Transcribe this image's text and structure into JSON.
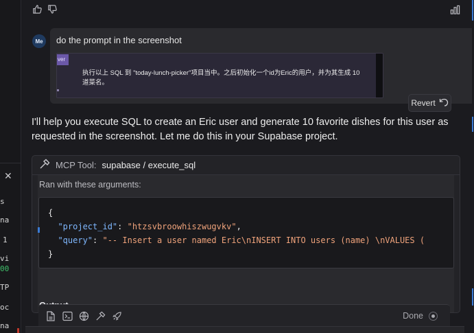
{
  "left_pane": {
    "close_glyph": "✕",
    "fragments": [
      "s",
      "na",
      "1",
      "vi",
      "00",
      "TP",
      "oc",
      "na"
    ]
  },
  "feedback": {
    "thumbs_up": "thumbs-up-icon",
    "thumbs_down": "thumbs-down-icon",
    "stats": "bar-chart-icon"
  },
  "user_message": {
    "avatar": "Me",
    "text": "do the prompt in the screenshot",
    "screenshot_tag": "ver",
    "screenshot_text": "执行以上 SQL 到 \"today-lunch-picker\"项目当中。之后初始化一个id为Eric的用户，并为其生成 10 道菜名。",
    "revert_label": "Revert"
  },
  "assistant": {
    "text": "I'll help you execute SQL to create an Eric user and generate 10 favorite dishes for this user as requested in the screenshot. Let me do this in your Supabase project."
  },
  "tool_call": {
    "label": "MCP Tool:",
    "name": "supabase / execute_sql",
    "args_label": "Ran with these arguments:",
    "code_open": "{",
    "key1": "\"project_id\"",
    "val1": "\"htzsvbroowhiszwugvkv\"",
    "key2": "\"query\"",
    "val2": "\"-- Insert a user named Eric\\nINSERT INTO users (name) \\nVALUES (",
    "code_close": "}",
    "output_label": "Output"
  },
  "composer": {
    "status": "Done"
  }
}
